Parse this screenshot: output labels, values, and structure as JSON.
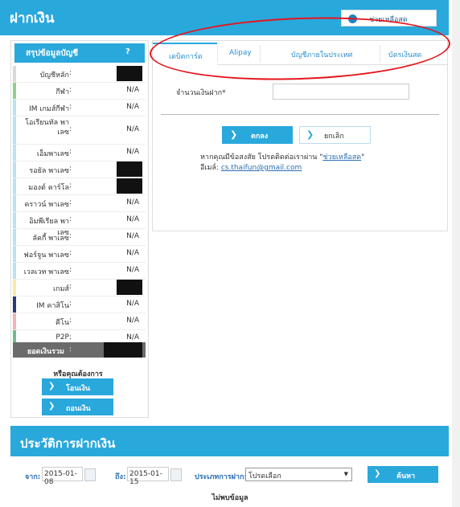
{
  "header": {
    "title": "ฝากเงิน",
    "help_label": "ช่วยเหลือสด",
    "help_icon": "chat-bubble-icon"
  },
  "account_summary": {
    "title": "สรุปข้อมูลบัญชี",
    "help_mark": "?",
    "rows": [
      {
        "name": "บัญชีหลัก",
        "value": "",
        "masked": true,
        "color": "#d9d9d9"
      },
      {
        "name": "กีฬา",
        "value": "N/A",
        "masked": false,
        "color": "#8bd38b"
      },
      {
        "name": "IM เกมส์กีฬา",
        "value": "N/A",
        "masked": false,
        "color": "#b9e3f3"
      },
      {
        "name": "โอเรียนทัล พาเลซ",
        "value": "N/A",
        "masked": false,
        "color": "#b9e3f3"
      },
      {
        "name": "เอ็มพาเลซ",
        "value": "N/A",
        "masked": false,
        "color": "#b9e3f3"
      },
      {
        "name": "รอยัล พาเลซ",
        "value": "",
        "masked": true,
        "color": "#b9e3f3"
      },
      {
        "name": "มองต์ คาร์โล",
        "value": "",
        "masked": true,
        "color": "#b9e3f3"
      },
      {
        "name": "คราวน์ พาเลซ",
        "value": "N/A",
        "masked": false,
        "color": "#b9e3f3"
      },
      {
        "name": "อิมพีเรียล พาเลซ",
        "value": "N/A",
        "masked": false,
        "color": "#b9e3f3"
      },
      {
        "name": "ลัคกี้ พาเลซ",
        "value": "N/A",
        "masked": false,
        "color": "#b9e3f3"
      },
      {
        "name": "ฟอร์จูน พาเลซ",
        "value": "N/A",
        "masked": false,
        "color": "#b9e3f3"
      },
      {
        "name": "เวลเวท พาเลซ",
        "value": "N/A",
        "masked": false,
        "color": "#b9e3f3"
      },
      {
        "name": "เกมส์",
        "value": "",
        "masked": true,
        "color": "#fbe9a0"
      },
      {
        "name": "IM คาสิโน",
        "value": "N/A",
        "masked": false,
        "color": "#2b3a78"
      },
      {
        "name": "คีโน",
        "value": "N/A",
        "masked": false,
        "color": "#f6b1b8"
      },
      {
        "name": "P2P",
        "value": "N/A",
        "masked": false,
        "color": "#6dbf8a"
      }
    ],
    "total_label": "ยอดเงินรวม",
    "question": "หรือคุณต้องการ",
    "transfer_label": "โอนเงิน",
    "withdraw_label": "ถอนเงิน"
  },
  "tabs": [
    {
      "label": "เดบิตการ์ด",
      "active": true
    },
    {
      "label": "Alipay",
      "active": false
    },
    {
      "label": "บัญชีภายในประเทศ",
      "active": false
    },
    {
      "label": "บัตรเงินสด",
      "active": false
    }
  ],
  "form": {
    "amount_label": "จำนวนเงินฝาก*",
    "amount_value": "",
    "ok_label": "ตกลง",
    "cancel_label": "ยกเลิก",
    "contact_prefix": "หากคุณมีข้อสงสัย โปรดติดต่อเราผ่าน \"",
    "contact_link": "ช่วยเหลือสด",
    "contact_suffix": "\"",
    "email_label": "อีเมล์: ",
    "email_value": "cs.thaifun@gmail.com"
  },
  "history": {
    "title": "ประวัติการฝากเงิน",
    "from_label": "จาก:",
    "from_value": "2015-01-08",
    "to_label": "ถึง:",
    "to_value": "2015-01-15",
    "type_label": "ประเภทการฝาก:",
    "type_value": "โปรดเลือก",
    "search_label": "ค้นหา",
    "no_data": "ไม่พบข้อมูล"
  },
  "colors": {
    "brand_blue": "#29a8dc",
    "annotation_red": "#e4161d",
    "total_bg": "#6b6b6b"
  }
}
